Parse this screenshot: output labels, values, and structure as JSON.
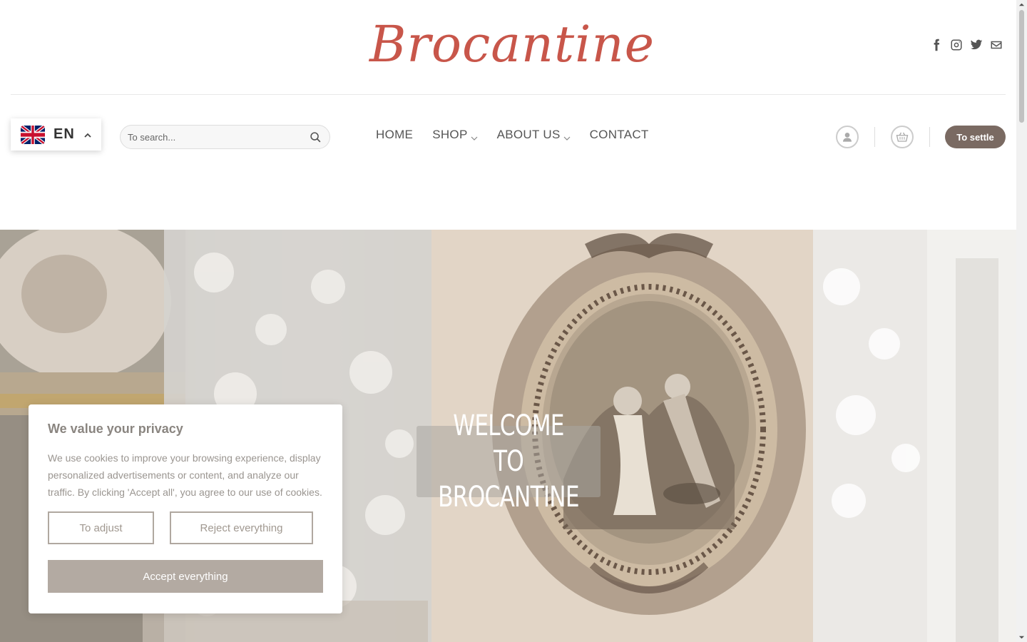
{
  "header": {
    "logo_text": "Brocantine",
    "social_icons": [
      "facebook-icon",
      "instagram-icon",
      "twitter-icon",
      "email-icon"
    ]
  },
  "language": {
    "code": "EN",
    "flag": "uk-flag-icon"
  },
  "search": {
    "placeholder": "To search..."
  },
  "nav": {
    "items": [
      {
        "label": "HOME",
        "has_dropdown": false
      },
      {
        "label": "SHOP",
        "has_dropdown": true
      },
      {
        "label": "ABOUT US",
        "has_dropdown": true
      },
      {
        "label": "CONTACT",
        "has_dropdown": false
      }
    ]
  },
  "actions": {
    "account_icon": "user-icon",
    "cart_icon": "basket-icon",
    "checkout_label": "To settle",
    "checkout_color": "#7a6a62"
  },
  "hero": {
    "welcome_text": "WELCOME TO BROCANTINE"
  },
  "cookie": {
    "title": "We value your privacy",
    "body": "We use cookies to improve your browsing experience, display personalized advertisements or content, and analyze our traffic. By clicking 'Accept all', you agree to our use of cookies.",
    "adjust_label": "To adjust",
    "reject_label": "Reject everything",
    "accept_label": "Accept everything"
  },
  "colors": {
    "brand": "#c8564a",
    "accept_bg": "#b3aaa2"
  }
}
